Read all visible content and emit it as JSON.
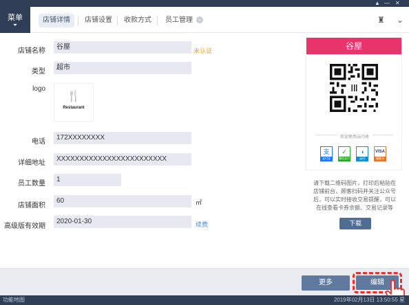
{
  "menu": {
    "label": "菜单",
    "arrow": "⏷"
  },
  "nav": {
    "tabs": [
      {
        "label": "店铺详情",
        "active": true
      },
      {
        "label": "店铺设置",
        "active": false
      },
      {
        "label": "收款方式",
        "active": false
      },
      {
        "label": "员工管理",
        "active": false,
        "dropdown_icon": "chevron-down-icon"
      }
    ],
    "right_icons": [
      "store-icon",
      "chevron-down-icon"
    ]
  },
  "form": {
    "store_name": {
      "label": "店铺名称",
      "value": "谷屋",
      "status": "未认证"
    },
    "type": {
      "label": "类型",
      "value": "超市"
    },
    "logo": {
      "label": "logo",
      "image_text": "Restaurant"
    },
    "phone": {
      "label": "电话",
      "value": "172XXXXXXXX"
    },
    "address": {
      "label": "详细地址",
      "value": "XXXXXXXXXXXXXXXXXXXXXXXX"
    },
    "staff_count": {
      "label": "员工数量",
      "value": "1"
    },
    "area": {
      "label": "店铺面积",
      "value": "60",
      "unit": "㎡"
    },
    "premium_expiry": {
      "label": "高级版有效期",
      "value": "2020-01-30",
      "action": "续费"
    }
  },
  "qr_card": {
    "title": "谷屋",
    "welcome": "欢迎使用云闪收",
    "payment_methods": [
      {
        "name": "支付宝",
        "icon": "alipay-icon",
        "color": "#1677ff"
      },
      {
        "name": "微信支付",
        "icon": "wechat-pay-icon",
        "color": "#1aad19"
      },
      {
        "name": "云闪",
        "icon": "unionpay-quickpass-icon",
        "color": "#0e8fd6"
      },
      {
        "name": "银联卡",
        "icon": "visa-card-icon",
        "color": "#e8732a"
      }
    ],
    "header_color": "#e8336b"
  },
  "instructions": "请下载二维码图片，打印后粘贴在店铺前台，顾客扫码并关注公众号后，可以实时接收交易提醒，可以在线查看卡券余额、交易记录等",
  "download_label": "下载",
  "footer": {
    "more_label": "更多",
    "edit_label": "编辑"
  },
  "statusbar": {
    "left": "功能地图",
    "right": "2019年02月13日 13:50:55 星"
  },
  "colors": {
    "accent": "#e8336b",
    "button": "#5f7a9e",
    "highlight": "#ef2d2d",
    "warning": "#f0a020",
    "link": "#4e8bd8",
    "dark": "#2f3e56"
  }
}
